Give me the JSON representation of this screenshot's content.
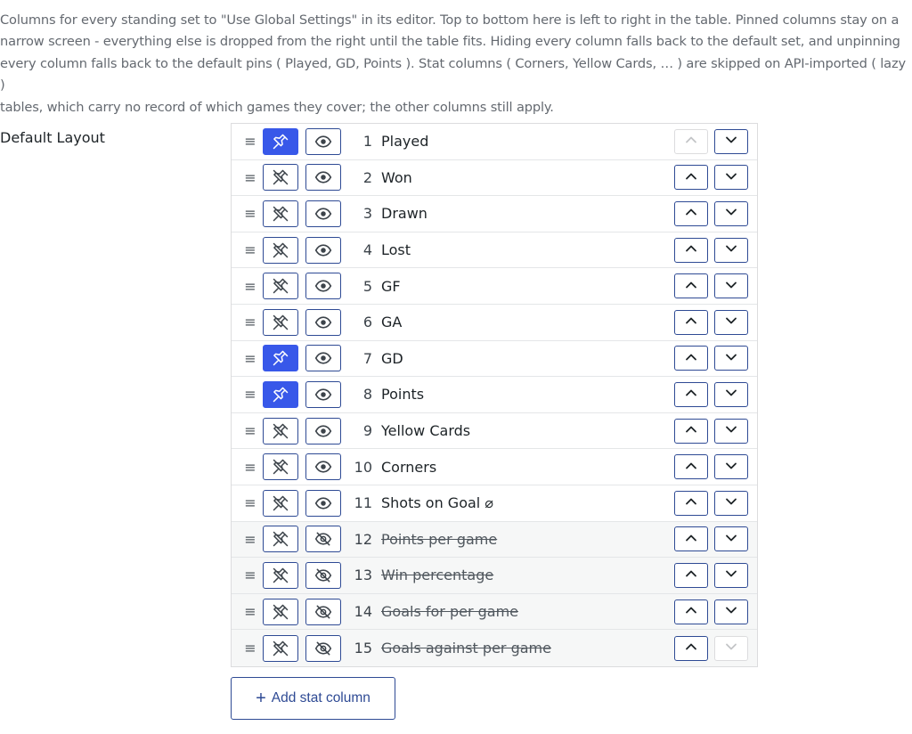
{
  "description": "Columns for every standing set to \"Use Global Settings\" in its editor. Top to bottom here is left to right in the table. Pinned columns stay on a\nnarrow screen - everything else is dropped from the right until the table fits. Hiding every column falls back to the default set, and unpinning\nevery column falls back to the default pins ( Played, GD, Points ). Stat columns ( Corners, Yellow Cards, … ) are skipped on API-imported ( lazy )\ntables, which carry no record of which games they cover; the other columns still apply.",
  "layout_label": "Default Layout",
  "columns": [
    {
      "num": "1",
      "name": "Played",
      "pinned": true,
      "visible": true
    },
    {
      "num": "2",
      "name": "Won",
      "pinned": false,
      "visible": true
    },
    {
      "num": "3",
      "name": "Drawn",
      "pinned": false,
      "visible": true
    },
    {
      "num": "4",
      "name": "Lost",
      "pinned": false,
      "visible": true
    },
    {
      "num": "5",
      "name": "GF",
      "pinned": false,
      "visible": true
    },
    {
      "num": "6",
      "name": "GA",
      "pinned": false,
      "visible": true
    },
    {
      "num": "7",
      "name": "GD",
      "pinned": true,
      "visible": true
    },
    {
      "num": "8",
      "name": "Points",
      "pinned": true,
      "visible": true
    },
    {
      "num": "9",
      "name": "Yellow Cards",
      "pinned": false,
      "visible": true
    },
    {
      "num": "10",
      "name": "Corners",
      "pinned": false,
      "visible": true
    },
    {
      "num": "11",
      "name": "Shots on Goal ⌀",
      "pinned": false,
      "visible": true
    },
    {
      "num": "12",
      "name": "Points per game",
      "pinned": false,
      "visible": false
    },
    {
      "num": "13",
      "name": "Win percentage",
      "pinned": false,
      "visible": false
    },
    {
      "num": "14",
      "name": "Goals for per game",
      "pinned": false,
      "visible": false
    },
    {
      "num": "15",
      "name": "Goals against per game",
      "pinned": false,
      "visible": false
    }
  ],
  "handle_glyph": "≡",
  "add_button": {
    "icon": "+",
    "label": "Add stat column"
  },
  "icons": {
    "pin": "pin-icon",
    "unpin": "pin-off-icon",
    "visible": "eye-icon",
    "hidden": "eye-off-icon",
    "move_up": "chevron-up-icon",
    "move_down": "chevron-down-icon",
    "drag": "drag-handle-icon"
  },
  "colors": {
    "accent": "#3858e9",
    "button_border": "#2e4a94",
    "disabled_border": "#dcdcde",
    "hidden_row_bg": "#f6f7f7",
    "text_muted": "#646970"
  }
}
